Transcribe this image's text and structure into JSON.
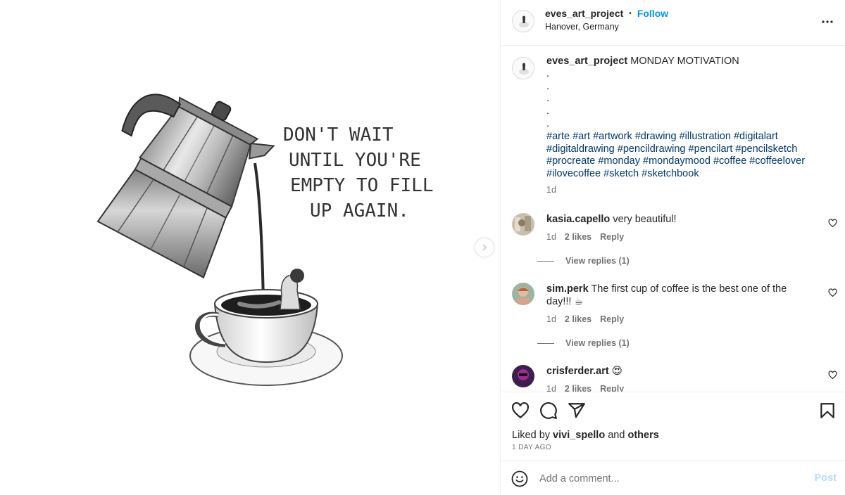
{
  "header": {
    "username": "eves_art_project",
    "separator": "•",
    "follow_label": "Follow",
    "location": "Hanover, Germany"
  },
  "artwork": {
    "lines": [
      "DON'T WAIT",
      "UNTIL YOU'RE",
      "EMPTY TO FILL",
      "UP AGAIN."
    ]
  },
  "caption": {
    "username": "eves_art_project",
    "text": "MONDAY MOTIVATION",
    "dots": [
      ".",
      ".",
      ".",
      ".",
      "."
    ],
    "hashtags": "#arte #art #artwork #drawing #illustration #digitalart #digitaldrawing #pencildrawing #pencilart #pencilsketch #procreate #monday #mondaymood #coffee #coffeelover #ilovecoffee #sketch #sketchbook",
    "time": "1d"
  },
  "comments": [
    {
      "username": "kasia.capello",
      "text": "very beautiful!",
      "time": "1d",
      "likes": "2 likes",
      "reply": "Reply",
      "view_replies": "View replies (1)"
    },
    {
      "username": "sim.perk",
      "text": "The first cup of coffee is the best one of the day!!! ☕",
      "time": "1d",
      "likes": "2 likes",
      "reply": "Reply",
      "view_replies": "View replies (1)"
    },
    {
      "username": "crisferder.art",
      "text": "😍",
      "time": "1d",
      "likes": "2 likes",
      "reply": "Reply"
    }
  ],
  "actions": {
    "liked_by_prefix": "Liked by",
    "liked_by_user": "vivi_spello",
    "liked_by_and": "and",
    "liked_by_others": "others",
    "time_ago": "1 DAY AGO"
  },
  "composer": {
    "placeholder": "Add a comment...",
    "post_label": "Post"
  },
  "icons": {
    "more": "more-options-icon",
    "like": "heart-icon",
    "comment": "comment-icon",
    "share": "send-icon",
    "save": "bookmark-icon",
    "emoji": "emoji-icon",
    "next": "chevron-right-icon"
  },
  "colors": {
    "link_blue": "#0095f6",
    "hashtag": "#00376b",
    "secondary": "#737373",
    "post_disabled": "#b3dbff"
  }
}
